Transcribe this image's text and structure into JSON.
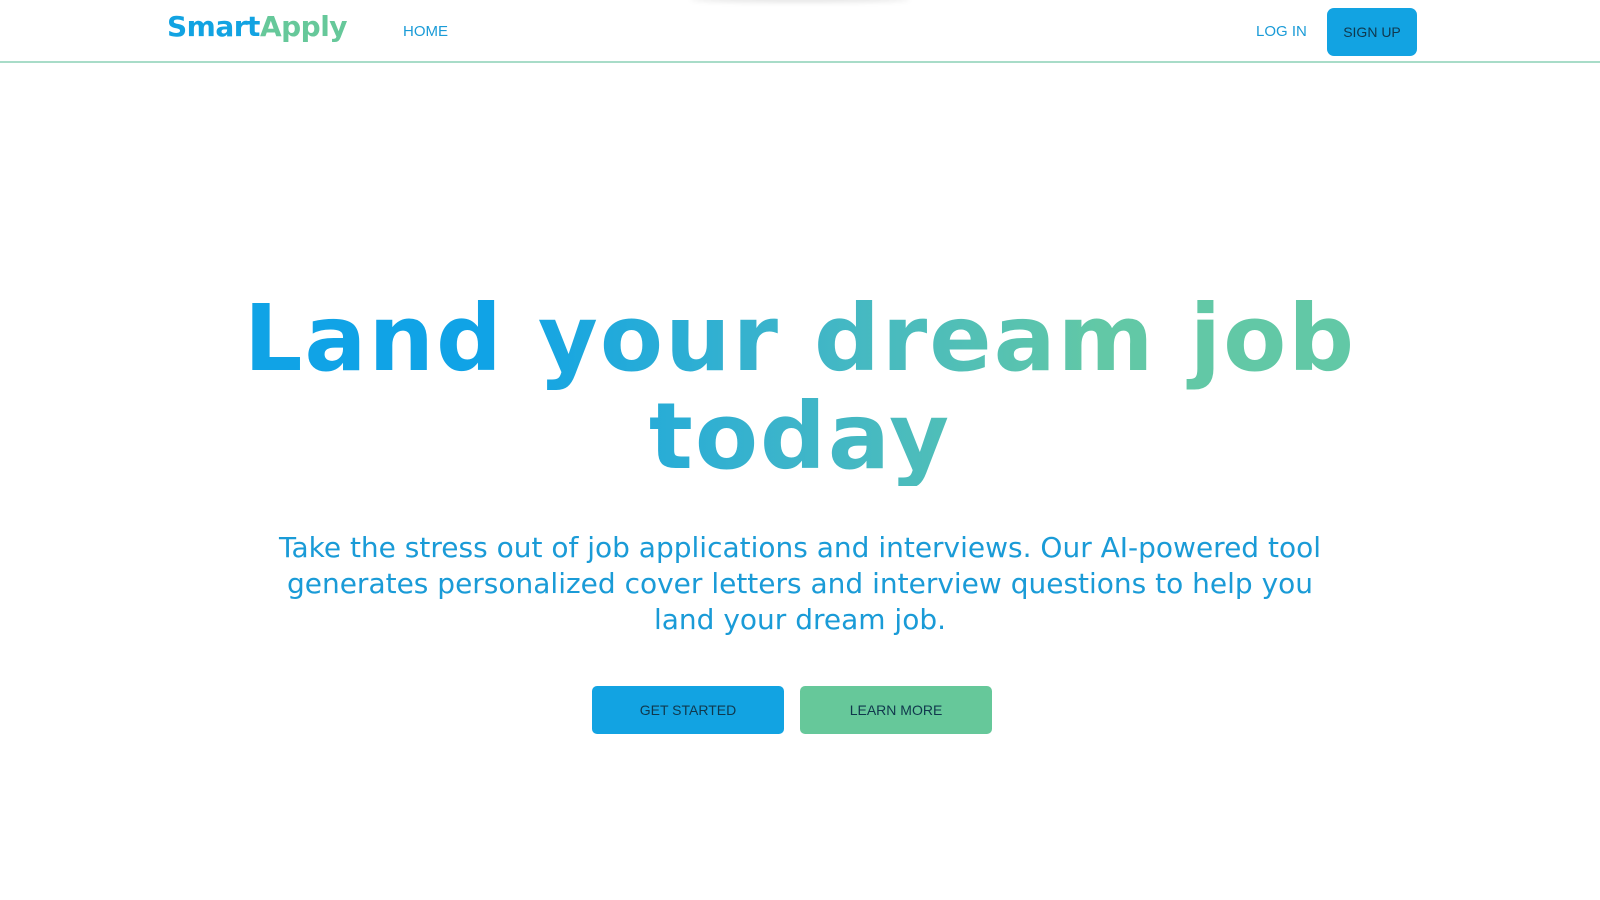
{
  "app": {
    "logo_part1": "Smart",
    "logo_part2": "Apply"
  },
  "nav": {
    "home_label": "HOME",
    "login_label": "LOG IN",
    "signup_label": "SIGN UP"
  },
  "hero": {
    "title": "Land your dream job today",
    "subtitle": "Take the stress out of job applications and interviews. Our AI-powered tool generates personalized cover letters and interview questions to help you land your dream job.",
    "primary_button": "GET STARTED",
    "secondary_button": "LEARN MORE"
  },
  "colors": {
    "brand_blue": "#12a3e2",
    "brand_green": "#66c89a",
    "text_blue": "#1a9bd7",
    "divider": "#a8dcc8"
  }
}
